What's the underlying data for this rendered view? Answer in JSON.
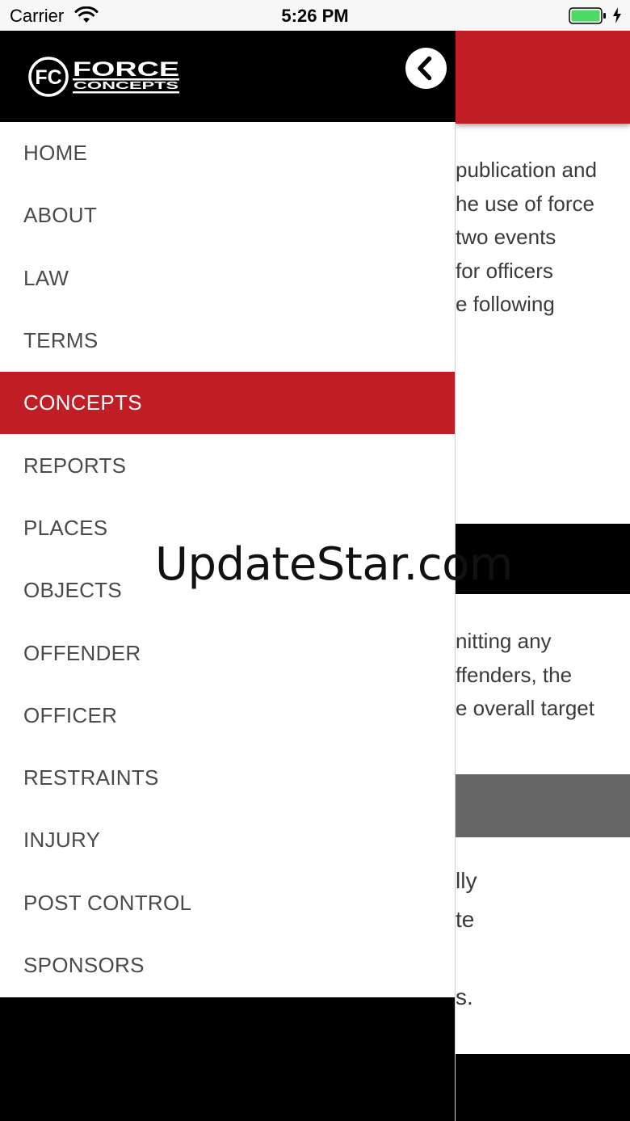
{
  "status_bar": {
    "carrier": "Carrier",
    "time": "5:26 PM",
    "battery_color": "#4cd964"
  },
  "drawer": {
    "logo": {
      "monogram": "FC",
      "line1": "FORCE",
      "line2": "CONCEPTS"
    },
    "back_icon": "chevron-left-icon",
    "menu": [
      {
        "label": "HOME",
        "active": false
      },
      {
        "label": "ABOUT",
        "active": false
      },
      {
        "label": "LAW",
        "active": false
      },
      {
        "label": "TERMS",
        "active": false
      },
      {
        "label": "CONCEPTS",
        "active": true
      },
      {
        "label": "REPORTS",
        "active": false
      },
      {
        "label": "PLACES",
        "active": false
      },
      {
        "label": "OBJECTS",
        "active": false
      },
      {
        "label": "OFFENDER",
        "active": false
      },
      {
        "label": "OFFICER",
        "active": false
      },
      {
        "label": "RESTRAINTS",
        "active": false
      },
      {
        "label": "INJURY",
        "active": false
      },
      {
        "label": "POST CONTROL",
        "active": false
      },
      {
        "label": "SPONSORS",
        "active": false
      }
    ]
  },
  "background_content": {
    "paragraph1": [
      "publication and",
      "he use of force",
      "two events",
      "for officers",
      "e following"
    ],
    "paragraph2": [
      "nitting any",
      "ffenders, the",
      "e overall target"
    ],
    "paragraph3": [
      "lly",
      "te",
      "",
      "s."
    ]
  },
  "watermark": "UpdateStar.com",
  "colors": {
    "accent": "#c11d24",
    "header_bg": "#000000",
    "menu_text": "#4a4a4a"
  }
}
